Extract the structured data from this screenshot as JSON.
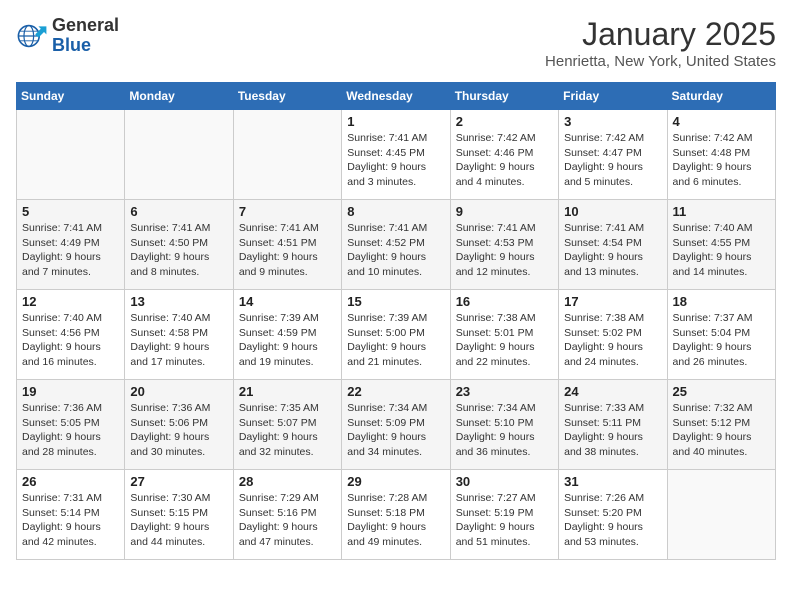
{
  "header": {
    "logo_line1": "General",
    "logo_line2": "Blue",
    "month": "January 2025",
    "location": "Henrietta, New York, United States"
  },
  "days_of_week": [
    "Sunday",
    "Monday",
    "Tuesday",
    "Wednesday",
    "Thursday",
    "Friday",
    "Saturday"
  ],
  "weeks": [
    [
      {
        "num": "",
        "info": ""
      },
      {
        "num": "",
        "info": ""
      },
      {
        "num": "",
        "info": ""
      },
      {
        "num": "1",
        "info": "Sunrise: 7:41 AM\nSunset: 4:45 PM\nDaylight: 9 hours and 3 minutes."
      },
      {
        "num": "2",
        "info": "Sunrise: 7:42 AM\nSunset: 4:46 PM\nDaylight: 9 hours and 4 minutes."
      },
      {
        "num": "3",
        "info": "Sunrise: 7:42 AM\nSunset: 4:47 PM\nDaylight: 9 hours and 5 minutes."
      },
      {
        "num": "4",
        "info": "Sunrise: 7:42 AM\nSunset: 4:48 PM\nDaylight: 9 hours and 6 minutes."
      }
    ],
    [
      {
        "num": "5",
        "info": "Sunrise: 7:41 AM\nSunset: 4:49 PM\nDaylight: 9 hours and 7 minutes."
      },
      {
        "num": "6",
        "info": "Sunrise: 7:41 AM\nSunset: 4:50 PM\nDaylight: 9 hours and 8 minutes."
      },
      {
        "num": "7",
        "info": "Sunrise: 7:41 AM\nSunset: 4:51 PM\nDaylight: 9 hours and 9 minutes."
      },
      {
        "num": "8",
        "info": "Sunrise: 7:41 AM\nSunset: 4:52 PM\nDaylight: 9 hours and 10 minutes."
      },
      {
        "num": "9",
        "info": "Sunrise: 7:41 AM\nSunset: 4:53 PM\nDaylight: 9 hours and 12 minutes."
      },
      {
        "num": "10",
        "info": "Sunrise: 7:41 AM\nSunset: 4:54 PM\nDaylight: 9 hours and 13 minutes."
      },
      {
        "num": "11",
        "info": "Sunrise: 7:40 AM\nSunset: 4:55 PM\nDaylight: 9 hours and 14 minutes."
      }
    ],
    [
      {
        "num": "12",
        "info": "Sunrise: 7:40 AM\nSunset: 4:56 PM\nDaylight: 9 hours and 16 minutes."
      },
      {
        "num": "13",
        "info": "Sunrise: 7:40 AM\nSunset: 4:58 PM\nDaylight: 9 hours and 17 minutes."
      },
      {
        "num": "14",
        "info": "Sunrise: 7:39 AM\nSunset: 4:59 PM\nDaylight: 9 hours and 19 minutes."
      },
      {
        "num": "15",
        "info": "Sunrise: 7:39 AM\nSunset: 5:00 PM\nDaylight: 9 hours and 21 minutes."
      },
      {
        "num": "16",
        "info": "Sunrise: 7:38 AM\nSunset: 5:01 PM\nDaylight: 9 hours and 22 minutes."
      },
      {
        "num": "17",
        "info": "Sunrise: 7:38 AM\nSunset: 5:02 PM\nDaylight: 9 hours and 24 minutes."
      },
      {
        "num": "18",
        "info": "Sunrise: 7:37 AM\nSunset: 5:04 PM\nDaylight: 9 hours and 26 minutes."
      }
    ],
    [
      {
        "num": "19",
        "info": "Sunrise: 7:36 AM\nSunset: 5:05 PM\nDaylight: 9 hours and 28 minutes."
      },
      {
        "num": "20",
        "info": "Sunrise: 7:36 AM\nSunset: 5:06 PM\nDaylight: 9 hours and 30 minutes."
      },
      {
        "num": "21",
        "info": "Sunrise: 7:35 AM\nSunset: 5:07 PM\nDaylight: 9 hours and 32 minutes."
      },
      {
        "num": "22",
        "info": "Sunrise: 7:34 AM\nSunset: 5:09 PM\nDaylight: 9 hours and 34 minutes."
      },
      {
        "num": "23",
        "info": "Sunrise: 7:34 AM\nSunset: 5:10 PM\nDaylight: 9 hours and 36 minutes."
      },
      {
        "num": "24",
        "info": "Sunrise: 7:33 AM\nSunset: 5:11 PM\nDaylight: 9 hours and 38 minutes."
      },
      {
        "num": "25",
        "info": "Sunrise: 7:32 AM\nSunset: 5:12 PM\nDaylight: 9 hours and 40 minutes."
      }
    ],
    [
      {
        "num": "26",
        "info": "Sunrise: 7:31 AM\nSunset: 5:14 PM\nDaylight: 9 hours and 42 minutes."
      },
      {
        "num": "27",
        "info": "Sunrise: 7:30 AM\nSunset: 5:15 PM\nDaylight: 9 hours and 44 minutes."
      },
      {
        "num": "28",
        "info": "Sunrise: 7:29 AM\nSunset: 5:16 PM\nDaylight: 9 hours and 47 minutes."
      },
      {
        "num": "29",
        "info": "Sunrise: 7:28 AM\nSunset: 5:18 PM\nDaylight: 9 hours and 49 minutes."
      },
      {
        "num": "30",
        "info": "Sunrise: 7:27 AM\nSunset: 5:19 PM\nDaylight: 9 hours and 51 minutes."
      },
      {
        "num": "31",
        "info": "Sunrise: 7:26 AM\nSunset: 5:20 PM\nDaylight: 9 hours and 53 minutes."
      },
      {
        "num": "",
        "info": ""
      }
    ]
  ]
}
